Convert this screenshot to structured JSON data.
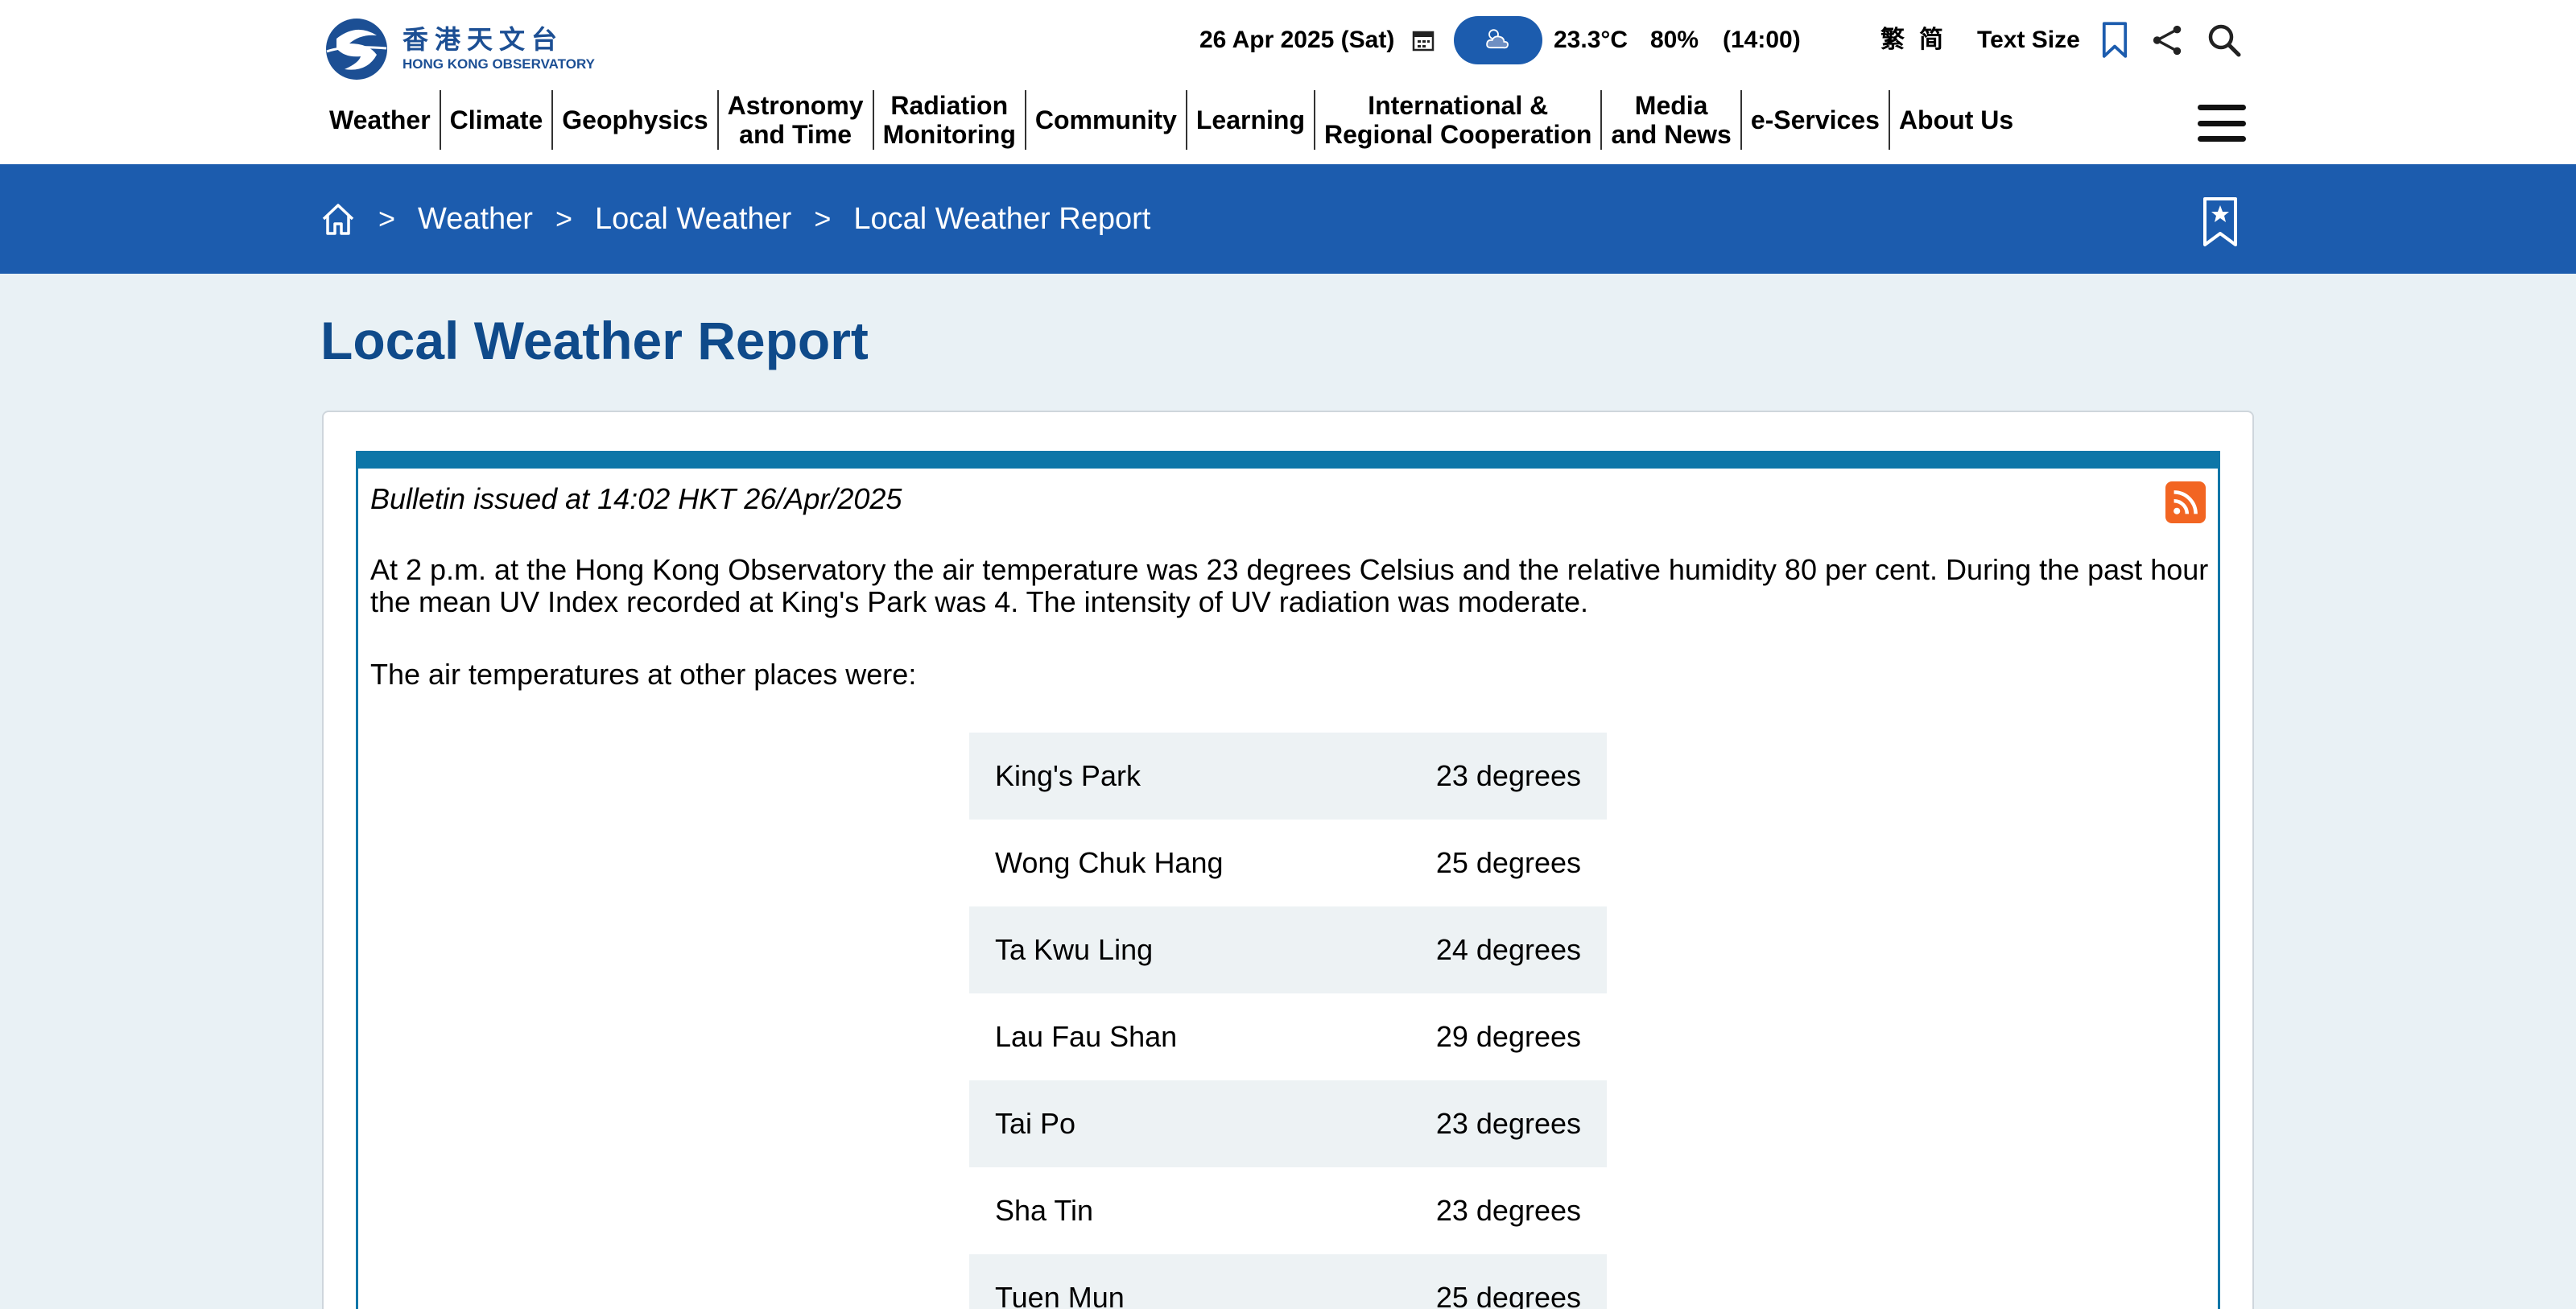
{
  "header": {
    "logo": {
      "chinese": "香港天文台",
      "english": "HONG KONG OBSERVATORY"
    },
    "date": "26 Apr 2025 (Sat)",
    "temperature": "23.3°C",
    "humidity": "80%",
    "time": "(14:00)",
    "lang_traditional": "繁",
    "lang_simplified": "简",
    "text_size_label": "Text Size"
  },
  "nav": {
    "items": [
      {
        "label": "Weather"
      },
      {
        "label": "Climate"
      },
      {
        "label": "Geophysics"
      },
      {
        "label": "Astronomy\nand Time"
      },
      {
        "label": "Radiation\nMonitoring"
      },
      {
        "label": "Community"
      },
      {
        "label": "Learning"
      },
      {
        "label": "International &\nRegional Cooperation"
      },
      {
        "label": "Media\nand News"
      },
      {
        "label": "e-Services"
      },
      {
        "label": "About Us"
      }
    ]
  },
  "breadcrumb": {
    "separator": ">",
    "items": [
      "Weather",
      "Local Weather",
      "Local Weather Report"
    ]
  },
  "page": {
    "title": "Local Weather Report",
    "issued": "Bulletin issued at 14:02 HKT 26/Apr/2025",
    "paragraph1": "At 2 p.m. at the Hong Kong Observatory the air temperature was 23 degrees Celsius and the relative humidity 80 per cent. During the past hour the mean UV Index recorded at King's Park was 4. The intensity of UV radiation was moderate.",
    "paragraph2": "The air temperatures at other places were:",
    "temperatures": [
      {
        "place": "King's Park",
        "value": "23 degrees"
      },
      {
        "place": "Wong Chuk Hang",
        "value": "25 degrees"
      },
      {
        "place": "Ta Kwu Ling",
        "value": "24 degrees"
      },
      {
        "place": "Lau Fau Shan",
        "value": "29 degrees"
      },
      {
        "place": "Tai Po",
        "value": "23 degrees"
      },
      {
        "place": "Sha Tin",
        "value": "23 degrees"
      },
      {
        "place": "Tuen Mun",
        "value": "25 degrees"
      }
    ]
  },
  "colors": {
    "brand_blue": "#1c5cae",
    "title_blue": "#0f4a8a",
    "bulletin_border": "#0d76a8",
    "rss_orange": "#f26522",
    "page_bg": "#e9f1f5"
  },
  "icons": {
    "calendar": "calendar-icon",
    "weather": "cloudy-icon",
    "bookmark": "bookmark-icon",
    "share": "share-icon",
    "search": "search-icon",
    "home": "home-icon",
    "bookmark_star": "bookmark-star-icon",
    "rss": "rss-icon",
    "menu": "hamburger-menu-icon"
  }
}
